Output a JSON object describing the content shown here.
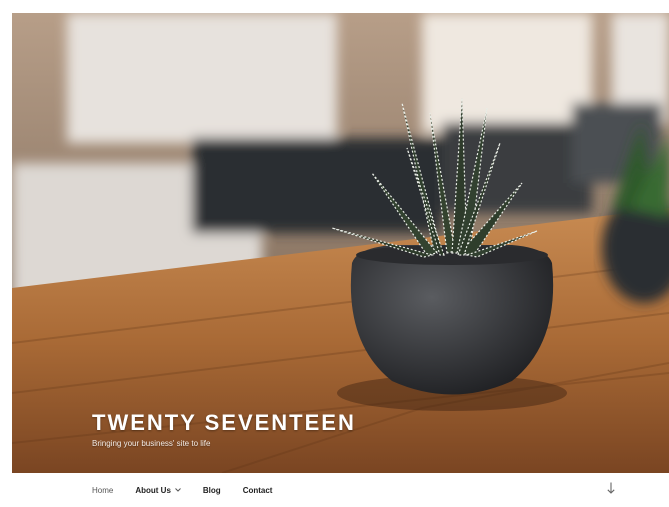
{
  "site": {
    "title": "TWENTY SEVENTEEN",
    "description": "Bringing your business' site to life"
  },
  "nav": {
    "items": [
      {
        "label": "Home"
      },
      {
        "label": "About Us",
        "has_submenu": true
      },
      {
        "label": "Blog"
      },
      {
        "label": "Contact"
      }
    ]
  },
  "icons": {
    "submenu": "chevron-down-icon",
    "scroll": "arrow-down-icon"
  },
  "colors": {
    "title": "#ffffff",
    "menu_text": "#222222",
    "nav_bg": "#ffffff"
  }
}
